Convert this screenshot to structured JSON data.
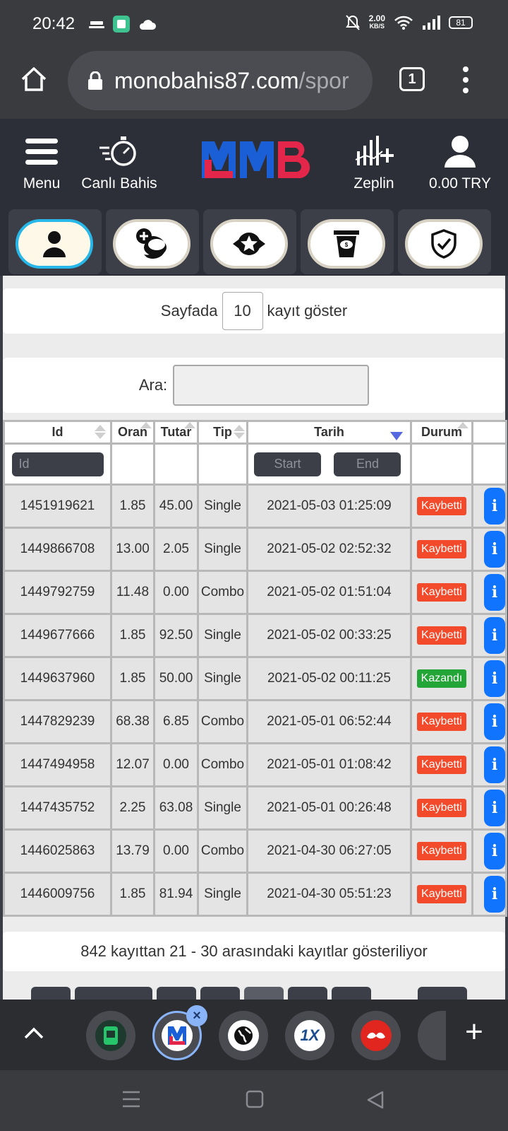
{
  "status_bar": {
    "time": "20:42",
    "speed_value": "2.00",
    "speed_unit": "KB/S",
    "battery": "81",
    "left_icons": [
      "cast-icon",
      "app-notification-icon",
      "cloud-icon"
    ],
    "right_icons": [
      "bell-off-icon",
      "wifi-icon",
      "signal-icon",
      "battery-icon"
    ]
  },
  "browser": {
    "url_domain": "monobahis87.com",
    "url_path": "/spor",
    "tab_count": "1"
  },
  "header": {
    "menu_label": "Menu",
    "live_label": "Canlı Bahis",
    "zeplin_label": "Zeplin",
    "balance": "0.00 TRY",
    "logo_colors": {
      "blue": "#1a5fd6",
      "red": "#e3264a"
    }
  },
  "categories": [
    {
      "icon": "user-icon",
      "active": true
    },
    {
      "icon": "add-coins-icon",
      "active": false
    },
    {
      "icon": "star-badge-icon",
      "active": false
    },
    {
      "icon": "cup-icon",
      "active": false
    },
    {
      "icon": "shield-check-icon",
      "active": false
    }
  ],
  "table_controls": {
    "length_prefix": "Sayfada",
    "length_value": "10",
    "length_suffix": "kayıt göster",
    "search_label": "Ara:",
    "search_value": ""
  },
  "table": {
    "columns": [
      "Id",
      "Oran",
      "Tutar",
      "Tip",
      "Tarih",
      "Durum",
      ""
    ],
    "filters": {
      "id_placeholder": "Id",
      "date_start": "Start",
      "date_end": "End"
    },
    "rows": [
      {
        "id": "1451919621",
        "oran": "1.85",
        "tutar": "45.00",
        "tip": "Single",
        "tarih": "2021-05-03 01:25:09",
        "durum": "Kaybetti",
        "won": false
      },
      {
        "id": "1449866708",
        "oran": "13.00",
        "tutar": "2.05",
        "tip": "Single",
        "tarih": "2021-05-02 02:52:32",
        "durum": "Kaybetti",
        "won": false
      },
      {
        "id": "1449792759",
        "oran": "11.48",
        "tutar": "0.00",
        "tip": "Combo",
        "tarih": "2021-05-02 01:51:04",
        "durum": "Kaybetti",
        "won": false
      },
      {
        "id": "1449677666",
        "oran": "1.85",
        "tutar": "92.50",
        "tip": "Single",
        "tarih": "2021-05-02 00:33:25",
        "durum": "Kaybetti",
        "won": false
      },
      {
        "id": "1449637960",
        "oran": "1.85",
        "tutar": "50.00",
        "tip": "Single",
        "tarih": "2021-05-02 00:11:25",
        "durum": "Kazandı",
        "won": true
      },
      {
        "id": "1447829239",
        "oran": "68.38",
        "tutar": "6.85",
        "tip": "Combo",
        "tarih": "2021-05-01 06:52:44",
        "durum": "Kaybetti",
        "won": false
      },
      {
        "id": "1447494958",
        "oran": "12.07",
        "tutar": "0.00",
        "tip": "Combo",
        "tarih": "2021-05-01 01:08:42",
        "durum": "Kaybetti",
        "won": false
      },
      {
        "id": "1447435752",
        "oran": "2.25",
        "tutar": "63.08",
        "tip": "Single",
        "tarih": "2021-05-01 00:26:48",
        "durum": "Kaybetti",
        "won": false
      },
      {
        "id": "1446025863",
        "oran": "13.79",
        "tutar": "0.00",
        "tip": "Combo",
        "tarih": "2021-04-30 06:27:05",
        "durum": "Kaybetti",
        "won": false
      },
      {
        "id": "1446009756",
        "oran": "1.85",
        "tutar": "81.94",
        "tip": "Single",
        "tarih": "2021-04-30 05:51:23",
        "durum": "Kaybetti",
        "won": false
      }
    ],
    "info": "842 kayıttan 21 - 30 arasındaki kayıtlar gösteriliyor"
  },
  "tab_strip": {
    "tabs": [
      {
        "icon": "casino-app-icon"
      },
      {
        "icon": "monobahis-icon",
        "active": true
      },
      {
        "icon": "globe-icon"
      },
      {
        "icon": "1xbet-icon",
        "text": "1X"
      },
      {
        "icon": "red-brand-icon"
      }
    ]
  },
  "colors": {
    "lost": "#f24a2a",
    "won": "#23a537",
    "info": "#1174ff",
    "header_bg": "#2d2f38"
  }
}
